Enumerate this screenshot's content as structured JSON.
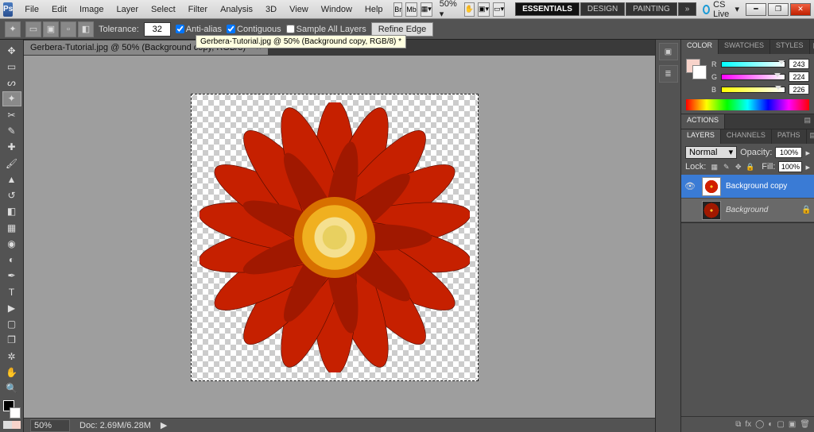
{
  "app_logo": "Ps",
  "menu": [
    "File",
    "Edit",
    "Image",
    "Layer",
    "Select",
    "Filter",
    "Analysis",
    "3D",
    "View",
    "Window",
    "Help"
  ],
  "zoom_dropdown": "50%",
  "workspaces": [
    "ESSENTIALS",
    "DESIGN",
    "PAINTING"
  ],
  "cslive": "CS Live",
  "options": {
    "tolerance_label": "Tolerance:",
    "tolerance": "32",
    "antialias": "Anti-alias",
    "contiguous": "Contiguous",
    "sample_all": "Sample All Layers",
    "refine": "Refine Edge"
  },
  "tooltip": "Gerbera-Tutorial.jpg @ 50% (Background copy, RGB/8) *",
  "doc_tab": "Gerbera-Tutorial.jpg @ 50% (Background copy, RGB/8) *",
  "statusbar": {
    "zoom": "50%",
    "doc": "Doc: 2.69M/6.28M"
  },
  "panels": {
    "color": {
      "tabs": [
        "COLOR",
        "SWATCHES",
        "STYLES"
      ],
      "r": {
        "label": "R",
        "value": "243"
      },
      "g": {
        "label": "G",
        "value": "224"
      },
      "b": {
        "label": "B",
        "value": "226"
      }
    },
    "actions_tab": "ACTIONS",
    "layers": {
      "tabs": [
        "LAYERS",
        "CHANNELS",
        "PATHS"
      ],
      "blend": "Normal",
      "opacity_label": "Opacity:",
      "opacity": "100%",
      "lock_label": "Lock:",
      "fill_label": "Fill:",
      "fill": "100%",
      "rows": [
        {
          "name": "Background copy"
        },
        {
          "name": "Background"
        }
      ]
    }
  }
}
